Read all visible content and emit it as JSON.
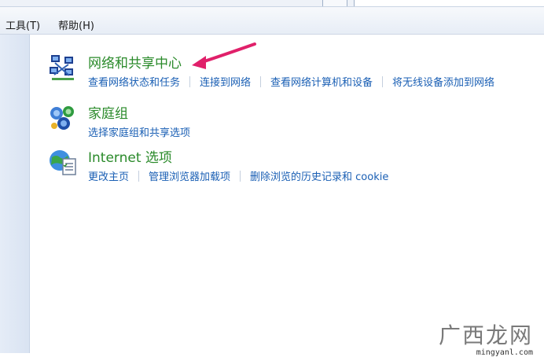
{
  "menu": {
    "tools": "工具(T)",
    "help": "帮助(H)"
  },
  "categories": [
    {
      "title": "网络和共享中心",
      "icon": "network-icon",
      "links": [
        "查看网络状态和任务",
        "连接到网络",
        "查看网络计算机和设备",
        "将无线设备添加到网络"
      ]
    },
    {
      "title": "家庭组",
      "icon": "homegroup-icon",
      "links": [
        "选择家庭组和共享选项"
      ]
    },
    {
      "title": "Internet 选项",
      "icon": "internet-options-icon",
      "links": [
        "更改主页",
        "管理浏览器加载项",
        "删除浏览的历史记录和 cookie"
      ]
    }
  ],
  "annotation": {
    "type": "arrow",
    "color": "#e0206a"
  },
  "watermark": {
    "title": "广西龙网",
    "url": "mingyanl.com"
  }
}
